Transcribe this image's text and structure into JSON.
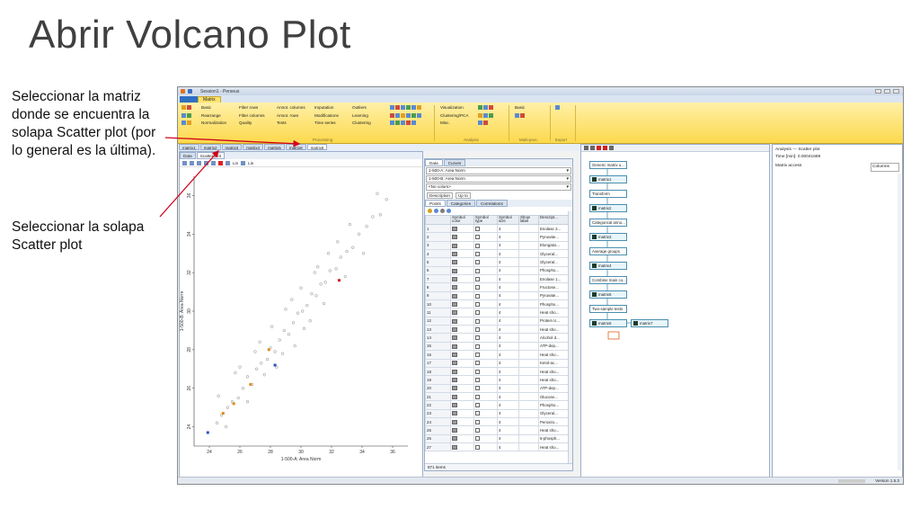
{
  "slide": {
    "title": "Abrir Volcano Plot",
    "note_tab": "Seleccionar la matriz donde se encuentra la solapa Scatter plot (por lo general es la última).",
    "note_scatter": "Seleccionar la solapa Scatter plot"
  },
  "app": {
    "window_title": "Session1 - Perseus",
    "ribbon_tab": "Matrix",
    "ribbon": {
      "processing": [
        "Basic",
        "Rearrange",
        "Normalization",
        "Filter rows",
        "Filter columns",
        "Quality",
        "Annot. columns",
        "Annot. rows",
        "Tests",
        "Imputation",
        "Modifications",
        "Time series",
        "Outliers",
        "Learning",
        "Clustering"
      ],
      "analysis": [
        "Visualization",
        "Clustering/PCA",
        "Misc."
      ],
      "multiproc": [
        "Basic"
      ],
      "group_labels": [
        "Processing",
        "Analysis",
        "Multi-proc.",
        "Export"
      ]
    },
    "matrix_tabs": [
      "matrix1",
      "matrix2",
      "matrix3",
      "matrix4",
      "matrix5",
      "matrix6",
      "matrix6"
    ],
    "active_matrix_tab": 6,
    "plot_tabs": [
      "Data",
      "Scatter plot"
    ],
    "plot_toolbar": {
      "x_scale": "Lin",
      "y_scale": "Lin"
    },
    "table": {
      "tabs": [
        "Data",
        "Curves"
      ],
      "x_column": "1-500-A: Area Norm",
      "y_column": "1-500-B: Area Norm",
      "colors": "<No colors>",
      "description": "Description",
      "up_to": "Up to",
      "sub_tabs": [
        "Points",
        "Categories",
        "Correlations"
      ],
      "headers": [
        "",
        "Symbol color",
        "Symbol type",
        "Symbol size",
        "Show label",
        "Descript..."
      ],
      "rows": [
        [
          "1",
          "4",
          "Enolase 2..."
        ],
        [
          "2",
          "4",
          "Pyruvate..."
        ],
        [
          "3",
          "4",
          "Elongatio..."
        ],
        [
          "4",
          "4",
          "Glyceral..."
        ],
        [
          "5",
          "4",
          "Glyceral..."
        ],
        [
          "6",
          "4",
          "Phospho..."
        ],
        [
          "7",
          "4",
          "Enolase 1..."
        ],
        [
          "8",
          "4",
          "Fructose..."
        ],
        [
          "9",
          "4",
          "Pyruvate..."
        ],
        [
          "10",
          "4",
          "Phospho..."
        ],
        [
          "11",
          "4",
          "Heat sho..."
        ],
        [
          "12",
          "4",
          "Protein U..."
        ],
        [
          "13",
          "4",
          "Heat sho..."
        ],
        [
          "14",
          "4",
          "Alcohol d..."
        ],
        [
          "15",
          "4",
          "ATP-dep..."
        ],
        [
          "16",
          "4",
          "Heat sho..."
        ],
        [
          "17",
          "4",
          "Ketol-ac..."
        ],
        [
          "18",
          "4",
          "Heat sho..."
        ],
        [
          "19",
          "4",
          "Heat sho..."
        ],
        [
          "20",
          "4",
          "ATP-dep..."
        ],
        [
          "21",
          "4",
          "Glucose..."
        ],
        [
          "22",
          "4",
          "Phospho..."
        ],
        [
          "23",
          "4",
          "Glyceral..."
        ],
        [
          "24",
          "4",
          "Peroxiro..."
        ],
        [
          "25",
          "4",
          "Heat sho..."
        ],
        [
          "26",
          "4",
          "6-phosph..."
        ],
        [
          "27",
          "4",
          "Heat sho..."
        ]
      ],
      "footer": "871 items"
    },
    "workflow": {
      "nodes": [
        "Generic matrix u...",
        "matrix1",
        "Transform",
        "matrix2",
        "Categorical anno...",
        "matrix3",
        "Average groups",
        "matrix4",
        "Combine main co...",
        "matrix5",
        "Two-sample tests",
        "matrix6",
        "matrix7"
      ]
    },
    "right_panel": {
      "line1": "Analysis --- Scatter plot",
      "line2": "Time [min]: 0.00041669",
      "matrix_access": "Matrix access",
      "columns": "Columns"
    },
    "status": "Version 1.5.3"
  },
  "colors": {
    "accent_red": "#d0021b",
    "ribbon": "#fcd94c",
    "points": "#a6a6a6"
  },
  "chart_data": {
    "type": "scatter",
    "title": "",
    "xlabel": "1-500-A: Area Norm",
    "ylabel": "1-500-B: Area Norm",
    "xlim": [
      23,
      37
    ],
    "ylim": [
      23,
      37
    ],
    "xticks": [
      24,
      26,
      28,
      30,
      32,
      34,
      36
    ],
    "yticks": [
      24,
      26,
      28,
      30,
      32,
      34,
      36
    ],
    "series": [
      {
        "points": [
          [
            24.5,
            24.2
          ],
          [
            24.8,
            24.6
          ],
          [
            25.2,
            25.0
          ],
          [
            25.5,
            25.3
          ],
          [
            25.9,
            25.5
          ],
          [
            26.2,
            26.0
          ],
          [
            26.5,
            26.6
          ],
          [
            26.8,
            26.2
          ],
          [
            27.1,
            27.0
          ],
          [
            27.4,
            27.3
          ],
          [
            27.8,
            27.5
          ],
          [
            28.0,
            28.1
          ],
          [
            28.3,
            27.9
          ],
          [
            28.6,
            28.5
          ],
          [
            28.9,
            29.0
          ],
          [
            29.2,
            28.8
          ],
          [
            29.5,
            29.4
          ],
          [
            29.8,
            29.9
          ],
          [
            30.1,
            30.0
          ],
          [
            30.4,
            30.3
          ],
          [
            30.7,
            30.9
          ],
          [
            31.0,
            30.8
          ],
          [
            31.3,
            31.4
          ],
          [
            31.6,
            31.5
          ],
          [
            31.9,
            32.1
          ],
          [
            32.3,
            32.2
          ],
          [
            32.6,
            32.8
          ],
          [
            33.0,
            33.1
          ],
          [
            33.4,
            33.3
          ],
          [
            33.8,
            34.0
          ],
          [
            34.3,
            34.4
          ],
          [
            34.7,
            34.9
          ],
          [
            35.2,
            35.0
          ],
          [
            35.6,
            35.8
          ],
          [
            27.0,
            27.9
          ],
          [
            28.1,
            29.2
          ],
          [
            29.0,
            30.1
          ],
          [
            30.0,
            31.2
          ],
          [
            31.1,
            32.3
          ],
          [
            26.5,
            25.3
          ],
          [
            27.6,
            26.7
          ],
          [
            28.8,
            27.8
          ],
          [
            30.2,
            29.1
          ],
          [
            31.5,
            30.4
          ],
          [
            24.6,
            25.6
          ],
          [
            25.7,
            26.8
          ],
          [
            32.4,
            33.6
          ],
          [
            33.2,
            34.5
          ],
          [
            29.6,
            28.2
          ],
          [
            30.9,
            32.0
          ],
          [
            26.0,
            27.1
          ],
          [
            27.3,
            28.4
          ],
          [
            28.4,
            27.1
          ],
          [
            29.4,
            30.6
          ],
          [
            30.6,
            29.5
          ],
          [
            31.8,
            33.0
          ],
          [
            32.9,
            31.8
          ],
          [
            25.1,
            24.0
          ],
          [
            34.1,
            33.0
          ],
          [
            35.0,
            36.1
          ]
        ]
      },
      {
        "name": "",
        "points": [
          [
            32.5,
            31.6
          ],
          [
            27.9,
            28.0
          ],
          [
            24.9,
            24.7
          ],
          [
            25.6,
            25.2
          ],
          [
            26.7,
            26.2
          ],
          [
            28.3,
            27.2
          ],
          [
            23.9,
            23.7
          ]
        ]
      }
    ]
  }
}
